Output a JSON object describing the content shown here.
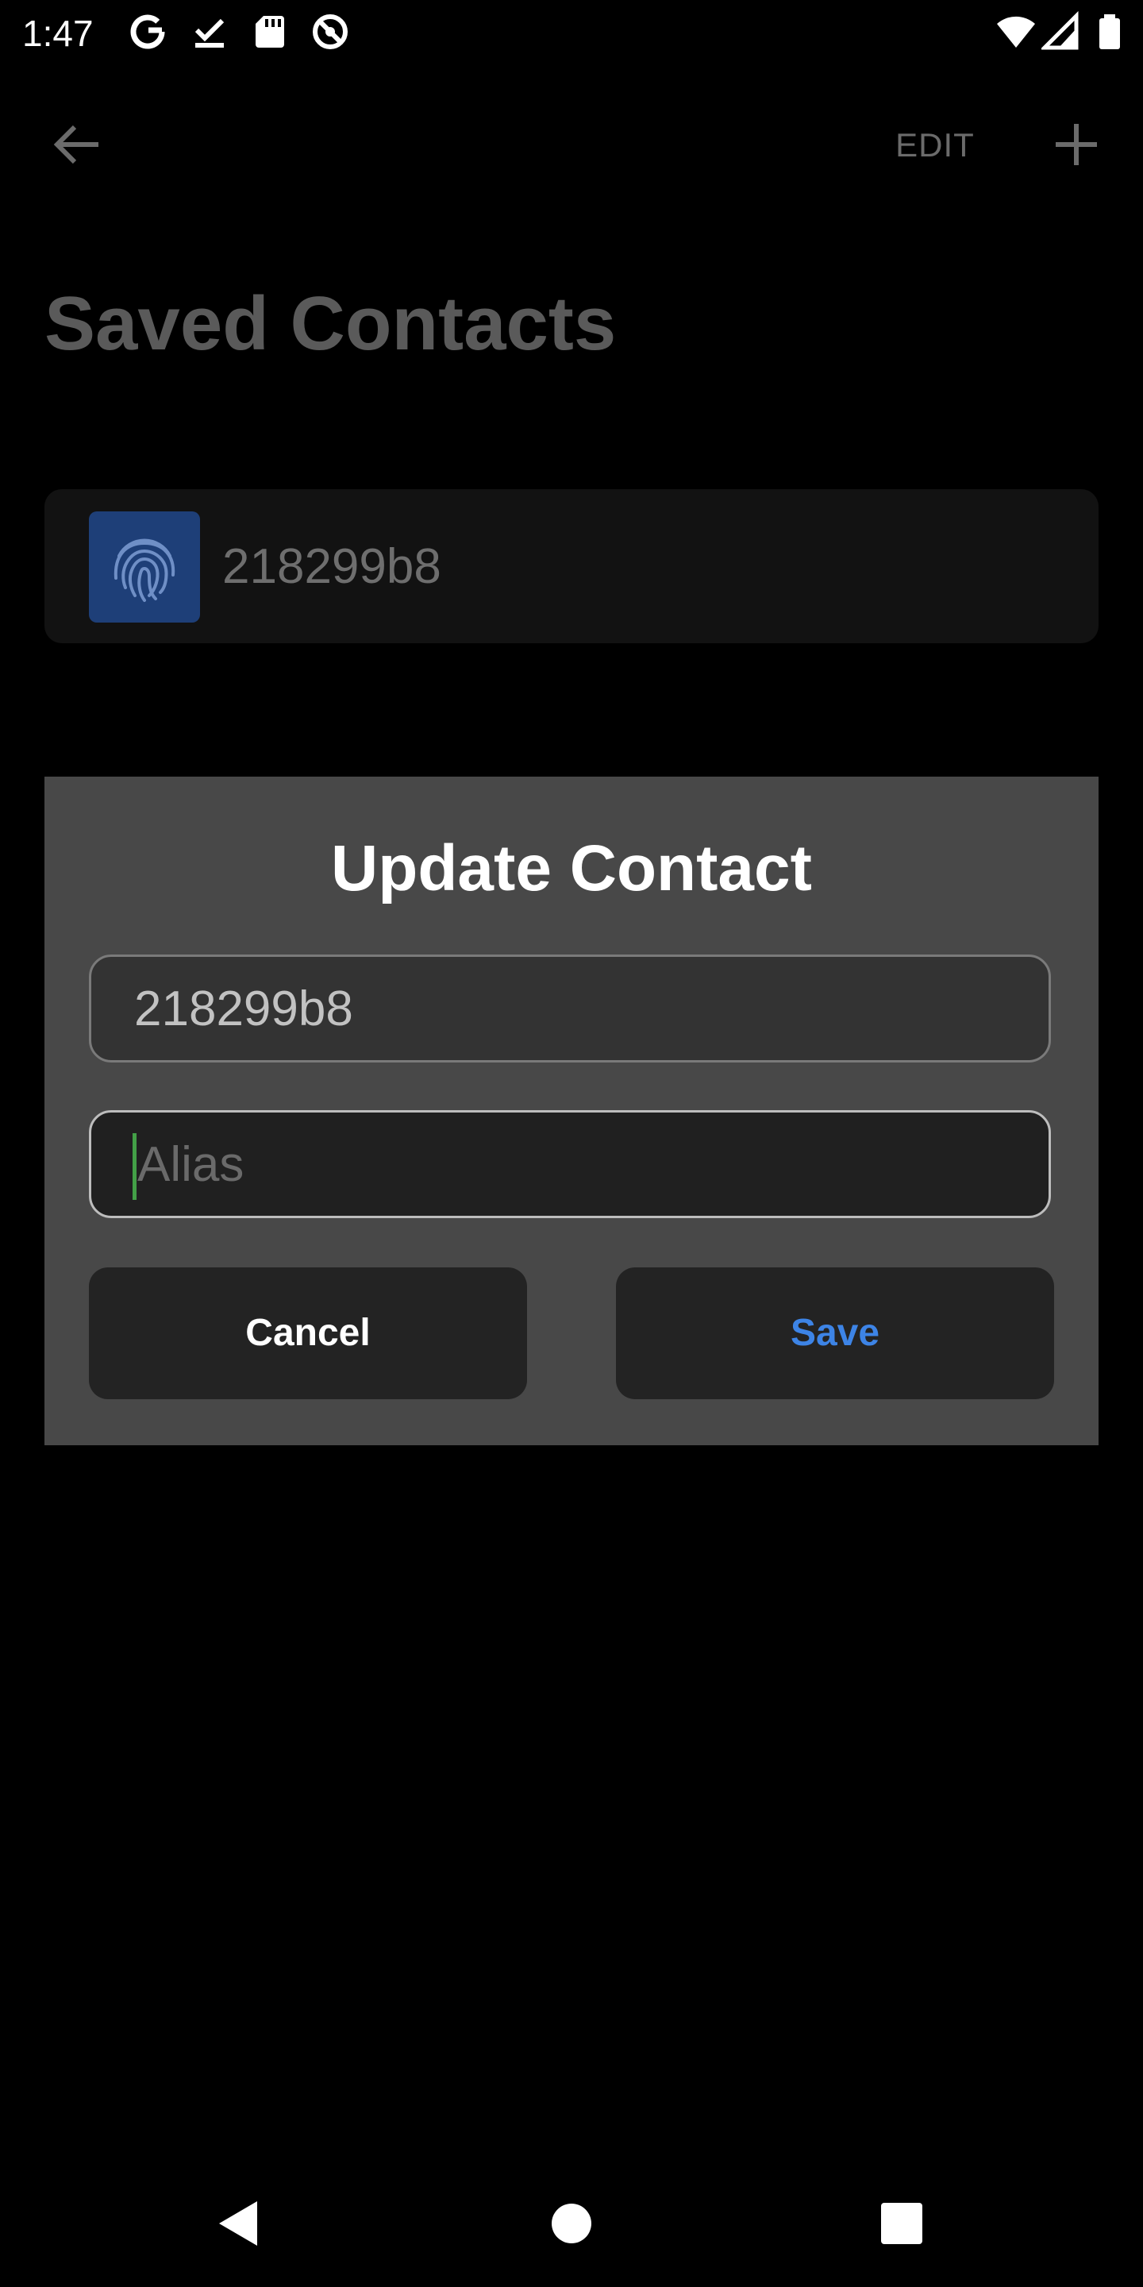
{
  "status_bar": {
    "time": "1:47",
    "left_icons": [
      "google-icon",
      "download-done-icon",
      "sd-card-icon",
      "do-not-disturb-icon"
    ],
    "right_icons": [
      "wifi-icon",
      "cell-signal-icon",
      "battery-icon"
    ]
  },
  "app_bar": {
    "back_icon": "arrow-back-icon",
    "edit_label": "EDIT",
    "add_icon": "plus-icon"
  },
  "page": {
    "title": "Saved Contacts"
  },
  "contacts": [
    {
      "name": "218299b8",
      "avatar_icon": "fingerprint-icon",
      "avatar_color": "#1e3f78"
    }
  ],
  "dialog": {
    "title": "Update Contact",
    "id_field_value": "218299b8",
    "alias_placeholder": "Alias",
    "cancel_label": "Cancel",
    "save_label": "Save",
    "accent_color": "#3d84e6",
    "caret_color": "#43a047"
  },
  "nav_bar": {
    "icons": [
      "nav-back-icon",
      "nav-home-icon",
      "nav-recents-icon"
    ]
  }
}
